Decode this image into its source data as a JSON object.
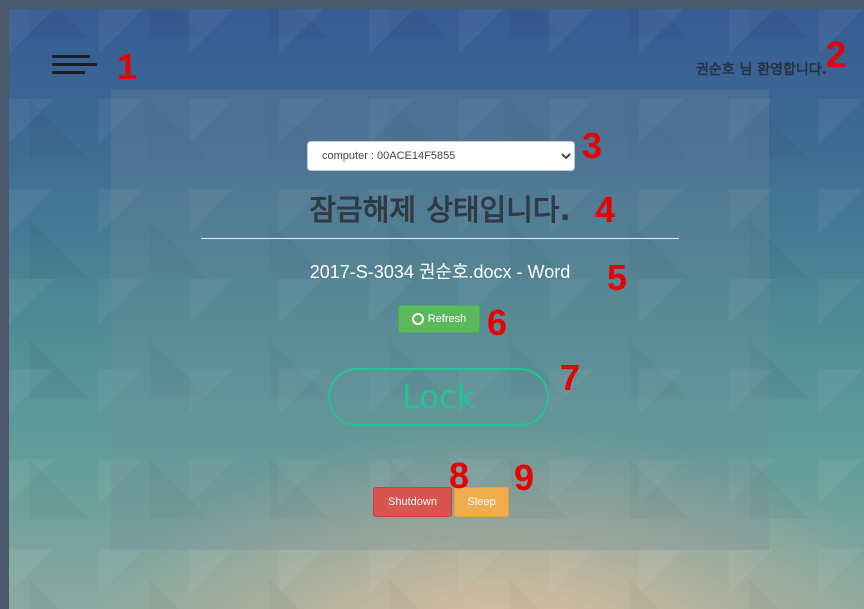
{
  "header": {
    "menu_icon": "hamburger-menu-icon",
    "welcome_text": "권순호 님 환영합니다."
  },
  "computer_select": {
    "selected": "computer : 00ACE14F5855"
  },
  "status": {
    "title": "잠금해제 상태입니다."
  },
  "document": {
    "title": "2017-S-3034 권순호.docx - Word"
  },
  "buttons": {
    "refresh_label": "Refresh",
    "refresh_icon": "circle-refresh-icon",
    "lock_label": "Lock",
    "shutdown_label": "Shutdown",
    "sleep_label": "Sleep"
  },
  "annotations": [
    "1",
    "2",
    "3",
    "4",
    "5",
    "6",
    "7",
    "8",
    "9"
  ],
  "colors": {
    "refresh": "#5cb85c",
    "lock": "#22c592",
    "shutdown": "#d9534f",
    "sleep": "#f0ad4e",
    "annotation": "#e60000"
  }
}
